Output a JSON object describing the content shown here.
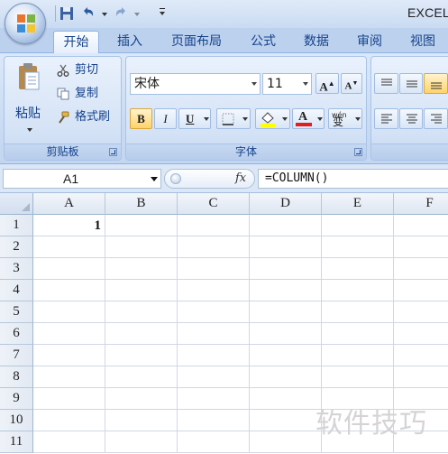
{
  "title_bar": {
    "app_title": "EXCEL"
  },
  "tabs": [
    {
      "label": "开始",
      "active": true
    },
    {
      "label": "插入",
      "active": false
    },
    {
      "label": "页面布局",
      "active": false
    },
    {
      "label": "公式",
      "active": false
    },
    {
      "label": "数据",
      "active": false
    },
    {
      "label": "审阅",
      "active": false
    },
    {
      "label": "视图",
      "active": false
    }
  ],
  "ribbon": {
    "clipboard": {
      "group_label": "剪贴板",
      "paste": "粘贴",
      "cut": "剪切",
      "copy": "复制",
      "format_painter": "格式刷"
    },
    "font": {
      "group_label": "字体",
      "font_name": "宋体",
      "font_size": "11",
      "bold": "B",
      "italic": "I",
      "underline": "U",
      "phonetic": "wén 变"
    }
  },
  "formula_bar": {
    "name_box": "A1",
    "fx": "fx",
    "formula": "=COLUMN()"
  },
  "sheet": {
    "columns": [
      "A",
      "B",
      "C",
      "D",
      "E",
      "F"
    ],
    "rows": [
      "1",
      "2",
      "3",
      "4",
      "5",
      "6",
      "7",
      "8",
      "9",
      "10",
      "11"
    ],
    "cells": {
      "A1": "1"
    }
  },
  "watermark": "软件技巧",
  "colors": {
    "ribbon_bg": "#cadcf3",
    "tab_text": "#15428b",
    "font_color_bar": "#e02020",
    "highlight_bar": "#ffff00"
  }
}
